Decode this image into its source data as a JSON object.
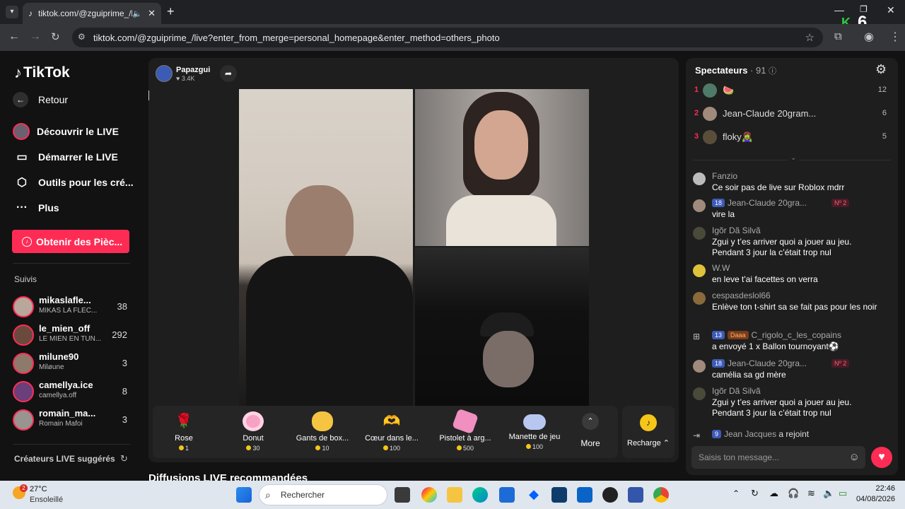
{
  "browser": {
    "tab_title": "tiktok.com/@zguiprime_/li",
    "url": "tiktok.com/@zguiprime_/live?enter_from_merge=personal_homepage&enter_method=others_photo",
    "corner_badge": "6"
  },
  "sidebar": {
    "logo": "TikTok",
    "back": "Retour",
    "nav": [
      "Découvrir le LIVE",
      "Démarrer le LIVE",
      "Outils pour les cré...",
      "Plus"
    ],
    "coins_button": "Obtenir des Pièc...",
    "following_header": "Suivis",
    "following": [
      {
        "name": "mikaslafle...",
        "sub": "MIKAS LA FLÈC...",
        "count": "38"
      },
      {
        "name": "le_mien_off",
        "sub": "LE MIEN EN TUN...",
        "count": "292"
      },
      {
        "name": "milune90",
        "sub": "Miløune",
        "count": "3"
      },
      {
        "name": "camellya.ice",
        "sub": "camellya.off",
        "count": "8"
      },
      {
        "name": "romain_ma...",
        "sub": "Romain Mafoi",
        "count": "3"
      }
    ],
    "suggested_header": "Créateurs LIVE suggérés",
    "live_badge": "LIVE"
  },
  "stream": {
    "host_name": "Papazgui",
    "host_likes": "3.4K",
    "recommended": "Diffusions LIVE recommandées"
  },
  "gifts": [
    {
      "name": "Rose",
      "price": "1",
      "icon": "rose-icon"
    },
    {
      "name": "Donut",
      "price": "30",
      "icon": "donut-icon"
    },
    {
      "name": "Gants de box...",
      "price": "10",
      "icon": "boxing-glove-icon"
    },
    {
      "name": "Cœur dans le...",
      "price": "100",
      "icon": "heart-hands-icon"
    },
    {
      "name": "Pistolet à arg...",
      "price": "500",
      "icon": "money-gun-icon"
    },
    {
      "name": "Manette de jeu",
      "price": "100",
      "icon": "gamepad-icon"
    }
  ],
  "gift_more": "More",
  "recharge": "Recharge",
  "viewers": {
    "title": "Spectateurs",
    "count": "· 91",
    "top": [
      {
        "rank": "1",
        "name": "🍉",
        "count": "12"
      },
      {
        "rank": "2",
        "name": "Jean-Claude 20gram...",
        "count": "6"
      },
      {
        "rank": "3",
        "name": "floky🧟‍♀️",
        "count": "5"
      }
    ]
  },
  "chat": [
    {
      "user": "Fanzio",
      "text": "Ce soir pas de live sur Roblox mdrr",
      "badges": []
    },
    {
      "user": "Jean-Claude 20gra...",
      "text": "vire la",
      "badges": [
        "18"
      ],
      "rank_badge": "Nº 2"
    },
    {
      "user": "Igõr Dã Silvã",
      "text": "Zgui y t’es arriver quoi a jouer au jeu. Pendant 3 jour la c’était trop nul",
      "badges": []
    },
    {
      "user": "W.W",
      "text": "en leve t'ai facettes on verra",
      "badges": []
    },
    {
      "user": "cespasdeslol66",
      "text": "Enlève ton t-shirt sa se fait pas pour les noir",
      "badges": []
    },
    {
      "user": "C_rigolo_c_les_copains",
      "text": "a envoyé 1 x Ballon tournoyant⚽",
      "badges": [
        "13"
      ],
      "fan_badge": "Daaa"
    },
    {
      "user": "Jean-Claude 20gra...",
      "text": "camélia sa gd mère",
      "badges": [
        "18"
      ],
      "rank_badge": "Nº 2"
    },
    {
      "user": "Igõr Dã Silvã",
      "text": "Zgui y t’es arriver quoi a jouer au jeu. Pendant 3 jour la c’était trop nul",
      "badges": []
    }
  ],
  "join": {
    "badge": "9",
    "user": "Jean Jacques",
    "text": "a rejoint"
  },
  "chat_input_placeholder": "Saisis ton message...",
  "taskbar": {
    "temp": "27°C",
    "weather": "Ensoleillé",
    "weather_badge": "2",
    "search": "Rechercher",
    "time": "22:46",
    "date": "04/08/2026"
  }
}
